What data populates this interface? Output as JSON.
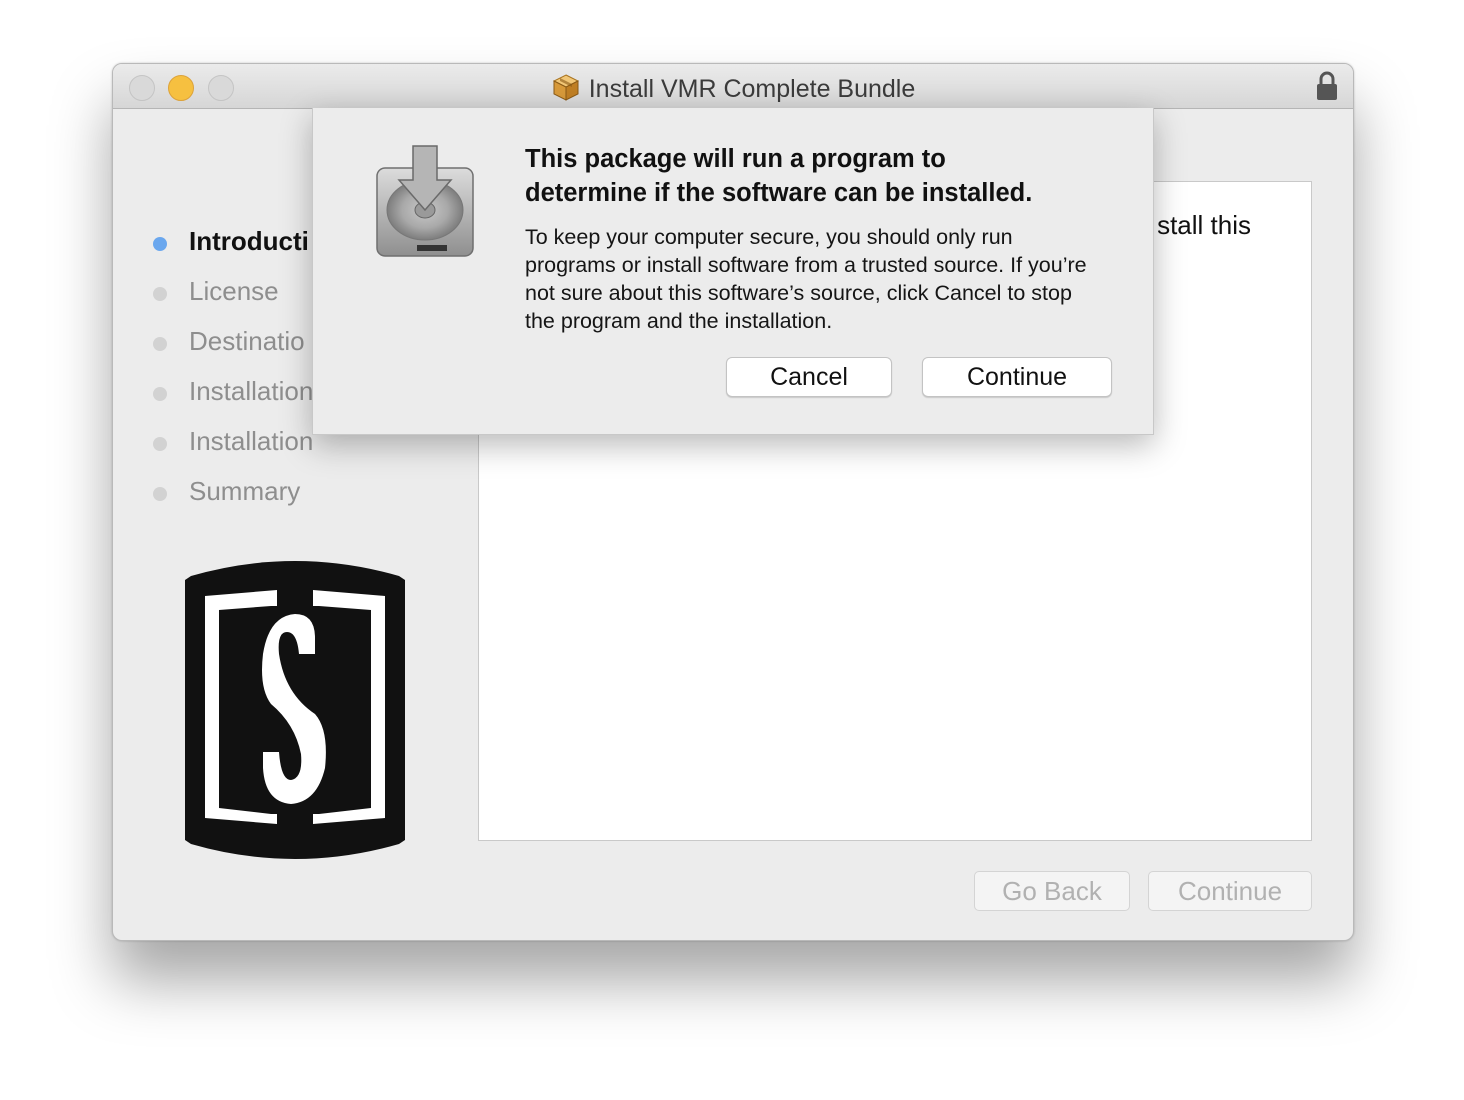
{
  "window": {
    "title": "Install VMR Complete Bundle"
  },
  "sidebar": {
    "steps": [
      {
        "label": "Introducti",
        "active": true
      },
      {
        "label": "License",
        "active": false
      },
      {
        "label": "Destinatio",
        "active": false
      },
      {
        "label": "Installation",
        "active": false
      },
      {
        "label": "Installation",
        "active": false
      },
      {
        "label": "Summary",
        "active": false
      }
    ]
  },
  "content": {
    "partial_text": "stall this"
  },
  "footer": {
    "go_back_label": "Go Back",
    "continue_label": "Continue"
  },
  "dialog": {
    "icon": "installer-disk-icon",
    "heading": "This package will run a program to\ndetermine if the software can be installed.",
    "body": "To keep your computer secure, you should only run programs or install software from a trusted source. If you’re not sure about this software’s source, click Cancel to stop the program and the installation.",
    "cancel_label": "Cancel",
    "continue_label": "Continue"
  },
  "colors": {
    "active_step_dot": "#6aa7ee",
    "inactive_step_dot": "#d2d2d2",
    "minimize_button": "#f6c040"
  }
}
